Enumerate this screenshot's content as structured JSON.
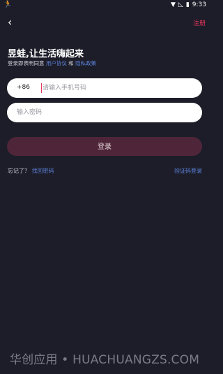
{
  "status_bar": {
    "time": "9:33",
    "icons": [
      "runner-icon",
      "wifi-icon",
      "signal-icon",
      "battery-icon"
    ]
  },
  "nav": {
    "register": "注册"
  },
  "header": {
    "title": "昱蛙,让生活嗨起来",
    "agreement_prefix": "登录即表明同意",
    "user_agreement": "用户协议",
    "and": "和",
    "privacy_policy": "隐私政策"
  },
  "form": {
    "country_code": "+86",
    "phone_placeholder": "请输入手机号码",
    "password_placeholder": "输入密码",
    "login_label": "登录"
  },
  "footer_links": {
    "forgot_prefix": "忘记了？",
    "find_password": "找回密码",
    "sms_login": "验证码登录"
  },
  "watermark": "华创应用 • HUACHUANGZS.COM",
  "colors": {
    "background": "#1d1d29",
    "accent": "#e9375a",
    "link": "#5b82d9",
    "login_button": "#4f2639"
  }
}
